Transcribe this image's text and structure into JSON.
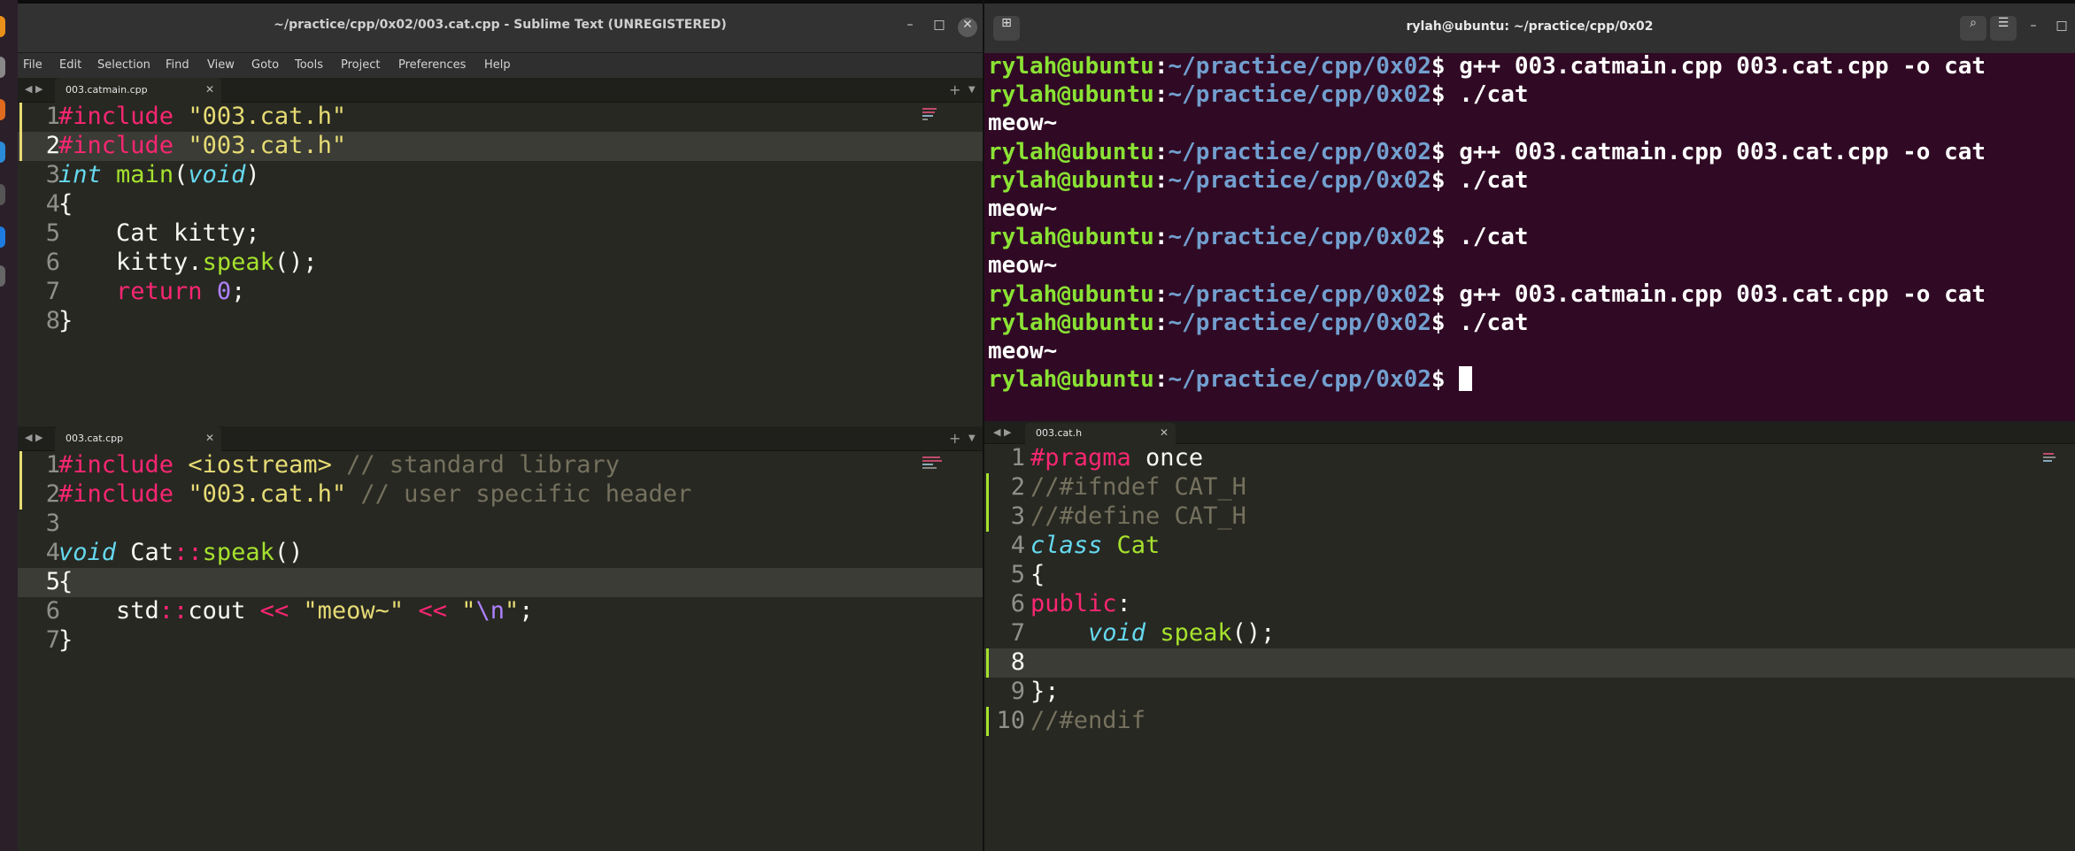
{
  "sublime": {
    "title": "~/practice/cpp/0x02/003.cat.cpp - Sublime Text (UNREGISTERED)",
    "window_buttons": [
      "–",
      "□",
      "✕"
    ],
    "menu": [
      "File",
      "Edit",
      "Selection",
      "Find",
      "View",
      "Goto",
      "Tools",
      "Project",
      "Preferences",
      "Help"
    ],
    "top_pane": {
      "tab": "003.catmain.cpp",
      "lines": [
        {
          "n": "1",
          "mod": true,
          "active": false,
          "parts": [
            [
              "kw",
              "#include "
            ],
            [
              "str",
              "\"003.cat.h\""
            ]
          ]
        },
        {
          "n": "2",
          "mod": true,
          "active": true,
          "parts": [
            [
              "kw",
              "#include "
            ],
            [
              "str",
              "\"003.cat.h\""
            ]
          ]
        },
        {
          "n": "3",
          "mod": false,
          "active": false,
          "parts": [
            [
              "ty",
              "int"
            ],
            [
              "",
              " "
            ],
            [
              "fn",
              "main"
            ],
            [
              "",
              "("
            ],
            [
              "ty",
              "void"
            ],
            [
              "",
              ")"
            ]
          ]
        },
        {
          "n": "4",
          "mod": false,
          "active": false,
          "parts": [
            [
              "",
              "{"
            ]
          ]
        },
        {
          "n": "5",
          "mod": false,
          "active": false,
          "parts": [
            [
              "",
              "    Cat kitty;"
            ]
          ]
        },
        {
          "n": "6",
          "mod": false,
          "active": false,
          "parts": [
            [
              "",
              "    kitty."
            ],
            [
              "fn",
              "speak"
            ],
            [
              "",
              "();"
            ]
          ]
        },
        {
          "n": "7",
          "mod": false,
          "active": false,
          "parts": [
            [
              "",
              "    "
            ],
            [
              "kw",
              "return"
            ],
            [
              "",
              " "
            ],
            [
              "num",
              "0"
            ],
            [
              "",
              ";"
            ]
          ]
        },
        {
          "n": "8",
          "mod": false,
          "active": false,
          "parts": [
            [
              "",
              "}"
            ]
          ]
        }
      ]
    },
    "bottom_pane": {
      "tab": "003.cat.cpp",
      "lines": [
        {
          "n": "1",
          "mod": true,
          "active": false,
          "parts": [
            [
              "kw",
              "#include "
            ],
            [
              "str",
              "<iostream>"
            ],
            [
              "cm",
              " // standard library"
            ]
          ]
        },
        {
          "n": "2",
          "mod": true,
          "active": false,
          "parts": [
            [
              "kw",
              "#include "
            ],
            [
              "str",
              "\"003.cat.h\""
            ],
            [
              "cm",
              " // user specific header"
            ]
          ]
        },
        {
          "n": "3",
          "mod": false,
          "active": false,
          "parts": []
        },
        {
          "n": "4",
          "mod": false,
          "active": false,
          "parts": [
            [
              "ty",
              "void"
            ],
            [
              "",
              " Cat"
            ],
            [
              "kw",
              "::"
            ],
            [
              "fn",
              "speak"
            ],
            [
              "",
              "()"
            ]
          ]
        },
        {
          "n": "5",
          "mod": false,
          "active": true,
          "parts": [
            [
              "",
              "{"
            ]
          ]
        },
        {
          "n": "6",
          "mod": false,
          "active": false,
          "parts": [
            [
              "",
              "    std"
            ],
            [
              "kw",
              "::"
            ],
            [
              "",
              "cout "
            ],
            [
              "kw",
              "<<"
            ],
            [
              "",
              " "
            ],
            [
              "str",
              "\"meow~\""
            ],
            [
              "",
              " "
            ],
            [
              "kw",
              "<<"
            ],
            [
              "",
              " "
            ],
            [
              "str",
              "\""
            ],
            [
              "num",
              "\\n"
            ],
            [
              "str",
              "\""
            ],
            [
              "",
              ";"
            ]
          ]
        },
        {
          "n": "7",
          "mod": false,
          "active": false,
          "parts": [
            [
              "",
              "}"
            ]
          ]
        }
      ]
    }
  },
  "sublime2": {
    "tab": "003.cat.h",
    "lines": [
      {
        "n": "1",
        "mod": false,
        "active": false,
        "parts": [
          [
            "kw",
            "#pragma"
          ],
          [
            "",
            " once"
          ]
        ]
      },
      {
        "n": "2",
        "mod": true,
        "active": false,
        "parts": [
          [
            "cm",
            "//#ifndef CAT_H"
          ]
        ]
      },
      {
        "n": "3",
        "mod": true,
        "active": false,
        "parts": [
          [
            "cm",
            "//#define CAT_H"
          ]
        ]
      },
      {
        "n": "4",
        "mod": false,
        "active": false,
        "parts": [
          [
            "ty",
            "class"
          ],
          [
            "",
            " "
          ],
          [
            "cls",
            "Cat"
          ]
        ]
      },
      {
        "n": "5",
        "mod": false,
        "active": false,
        "parts": [
          [
            "",
            "{"
          ]
        ]
      },
      {
        "n": "6",
        "mod": false,
        "active": false,
        "parts": [
          [
            "kw",
            "public"
          ],
          [
            "",
            ":"
          ]
        ]
      },
      {
        "n": "7",
        "mod": false,
        "active": false,
        "parts": [
          [
            "",
            "    "
          ],
          [
            "ty",
            "void"
          ],
          [
            "",
            " "
          ],
          [
            "fn",
            "speak"
          ],
          [
            "",
            "();"
          ]
        ]
      },
      {
        "n": "8",
        "mod": true,
        "active": true,
        "parts": []
      },
      {
        "n": "9",
        "mod": false,
        "active": false,
        "parts": [
          [
            "",
            "};"
          ]
        ]
      },
      {
        "n": "10",
        "mod": true,
        "active": false,
        "parts": [
          [
            "cm",
            "//#endif"
          ]
        ]
      }
    ]
  },
  "terminal": {
    "title": "rylah@ubuntu: ~/practice/cpp/0x02",
    "prompt_user": "rylah@ubuntu",
    "prompt_path": "~/practice/cpp/0x02",
    "lines": [
      {
        "prompt": true,
        "cmd": "g++ 003.catmain.cpp 003.cat.cpp -o cat"
      },
      {
        "prompt": true,
        "cmd": "./cat"
      },
      {
        "prompt": false,
        "text": "meow~"
      },
      {
        "prompt": true,
        "cmd": "g++ 003.catmain.cpp 003.cat.cpp -o cat"
      },
      {
        "prompt": true,
        "cmd": "./cat"
      },
      {
        "prompt": false,
        "text": "meow~"
      },
      {
        "prompt": true,
        "cmd": "./cat"
      },
      {
        "prompt": false,
        "text": "meow~"
      },
      {
        "prompt": true,
        "cmd": "g++ 003.catmain.cpp 003.cat.cpp -o cat"
      },
      {
        "prompt": true,
        "cmd": "./cat"
      },
      {
        "prompt": false,
        "text": "meow~"
      },
      {
        "prompt": true,
        "cmd": "",
        "cursor": true
      }
    ]
  }
}
